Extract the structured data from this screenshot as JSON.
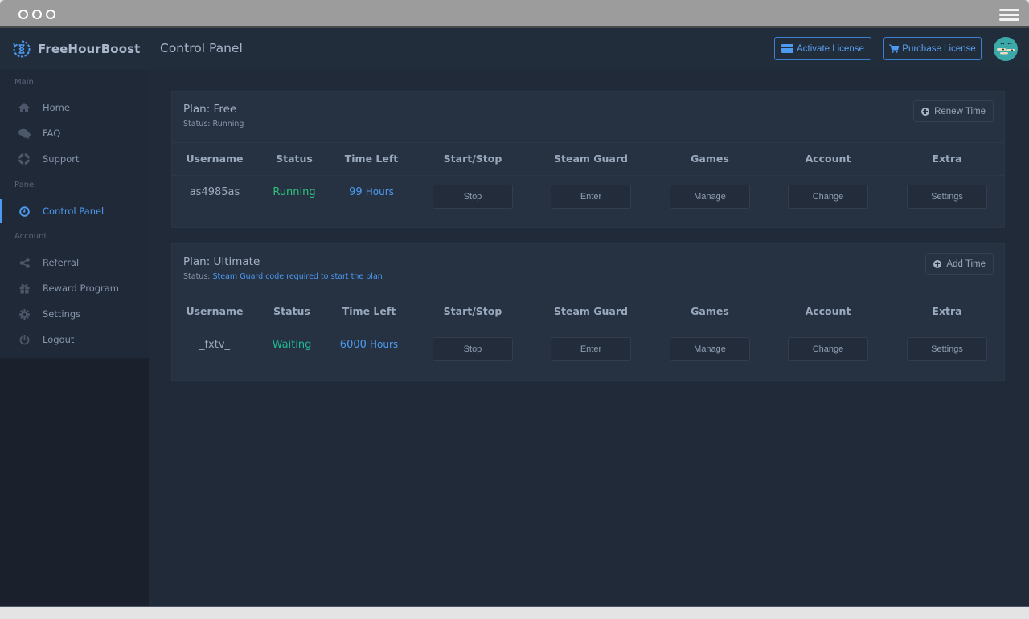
{
  "window": {
    "menu_icon": "hamburger-icon"
  },
  "header": {
    "brand": "FreeHourBoost",
    "brand_icon": "hourglass-refresh-icon",
    "page_title": "Control Panel",
    "activate_license": "Activate License",
    "purchase_license": "Purchase License",
    "avatar_icon": "avatar-face-icon"
  },
  "sidebar": {
    "sections": [
      {
        "label": "Main"
      },
      {
        "label": "Panel"
      },
      {
        "label": "Account"
      }
    ],
    "items": [
      {
        "label": "Home",
        "icon": "home-icon",
        "active": false
      },
      {
        "label": "FAQ",
        "icon": "chat-bubbles-icon",
        "active": false
      },
      {
        "label": "Support",
        "icon": "life-ring-icon",
        "active": false
      },
      {
        "label": "Control Panel",
        "icon": "clock-icon",
        "active": true
      },
      {
        "label": "Referral",
        "icon": "share-icon",
        "active": false
      },
      {
        "label": "Reward Program",
        "icon": "gift-icon",
        "active": false
      },
      {
        "label": "Settings",
        "icon": "gear-icon",
        "active": false
      },
      {
        "label": "Logout",
        "icon": "power-icon",
        "active": false
      }
    ]
  },
  "colors": {
    "accent": "#4d9bf0",
    "running": "#2ec27e",
    "waiting": "#1fb892"
  },
  "columns": [
    "Username",
    "Status",
    "Time Left",
    "Start/Stop",
    "Steam Guard",
    "Games",
    "Account",
    "Extra"
  ],
  "plans": [
    {
      "title": "Plan: Free",
      "status_label": "Status:",
      "status_value": "Running",
      "action": "Renew Time",
      "row": {
        "username": "as4985as",
        "status": "Running",
        "time_value": "99",
        "time_unit": "Hours",
        "start_stop": "Stop",
        "steam_guard": "Enter",
        "games": "Manage",
        "account": "Change",
        "extra": "Settings"
      }
    },
    {
      "title": "Plan: Ultimate",
      "status_label": "Status:",
      "status_value": "Steam Guard code required to start the plan",
      "action": "Add Time",
      "row": {
        "username": "_fxtv_",
        "status": "Waiting",
        "time_value": "6000",
        "time_unit": "Hours",
        "start_stop": "Stop",
        "steam_guard": "Enter",
        "games": "Manage",
        "account": "Change",
        "extra": "Settings"
      }
    }
  ]
}
